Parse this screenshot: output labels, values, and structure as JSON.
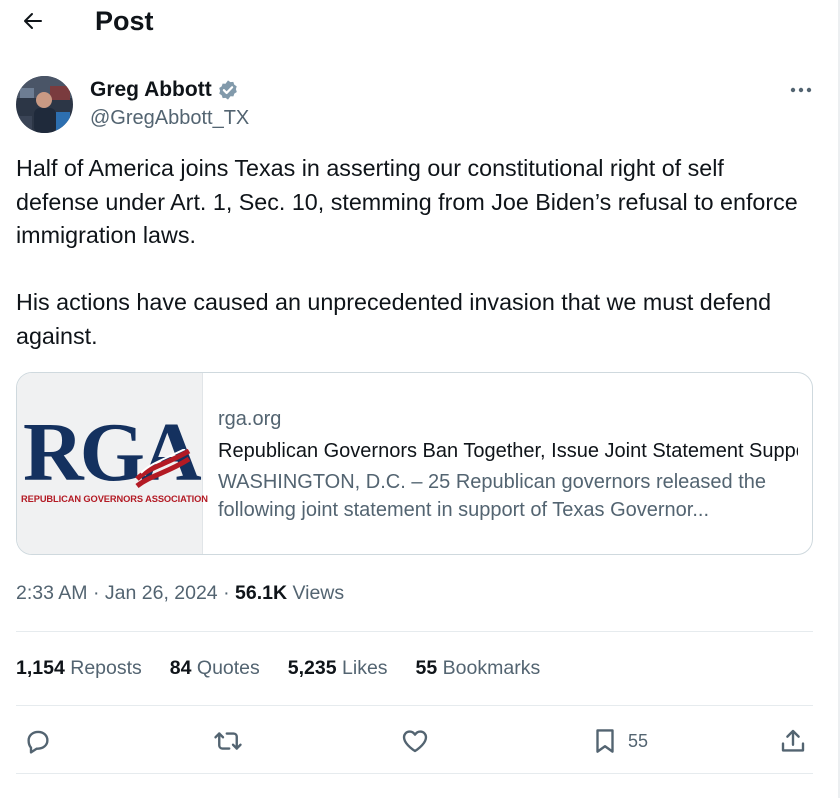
{
  "header": {
    "title": "Post",
    "back_icon": "arrow-left-icon"
  },
  "author": {
    "name": "Greg Abbott",
    "handle": "@GregAbbott_TX",
    "verified_icon": "verified-badge-icon",
    "verified_color": "#829aab"
  },
  "post": {
    "paragraphs": [
      "Half of America joins Texas in asserting our constitutional right of self defense under Art. 1, Sec. 10, stemming from Joe Biden’s refusal to enforce immigration laws.",
      "His actions have caused an unprecedented invasion that we must defend against."
    ]
  },
  "card": {
    "logo_text": "RGA",
    "logo_subtitle": "REPUBLICAN GOVERNORS ASSOCIATION",
    "domain": "rga.org",
    "title": "Republican Governors Ban Together, Issue Joint Statement Supporting Texas",
    "description": "WASHINGTON, D.C. – 25 Republican governors released the following joint statement in support of Texas Governor..."
  },
  "meta": {
    "time": "2:33 AM",
    "separator": "·",
    "date": "Jan 26, 2024",
    "views_count": "56.1K",
    "views_label": "Views"
  },
  "stats": {
    "reposts_count": "1,154",
    "reposts_label": "Reposts",
    "quotes_count": "84",
    "quotes_label": "Quotes",
    "likes_count": "5,235",
    "likes_label": "Likes",
    "bookmarks_count": "55",
    "bookmarks_label": "Bookmarks"
  },
  "actions": {
    "reply_icon": "reply-icon",
    "repost_icon": "repost-icon",
    "like_icon": "heart-icon",
    "bookmark_icon": "bookmark-icon",
    "bookmark_count": "55",
    "share_icon": "share-icon"
  },
  "colors": {
    "text": "#0f1419",
    "secondary": "#536471",
    "border": "#cfd9de",
    "rga_blue": "#14315f",
    "rga_red": "#b31a24"
  }
}
